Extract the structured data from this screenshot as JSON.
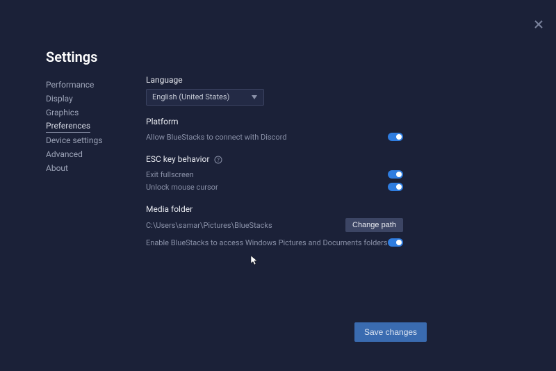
{
  "page_title": "Settings",
  "sidebar": {
    "items": [
      {
        "label": "Performance"
      },
      {
        "label": "Display"
      },
      {
        "label": "Graphics"
      },
      {
        "label": "Preferences"
      },
      {
        "label": "Device settings"
      },
      {
        "label": "Advanced"
      },
      {
        "label": "About"
      }
    ],
    "active_index": 3
  },
  "content": {
    "language": {
      "title": "Language",
      "selected": "English (United States)"
    },
    "platform": {
      "title": "Platform",
      "discord_label": "Allow BlueStacks to connect with Discord",
      "discord_on": true
    },
    "esc": {
      "title": "ESC key behavior",
      "exit_fullscreen_label": "Exit fullscreen",
      "exit_fullscreen_on": true,
      "unlock_cursor_label": "Unlock mouse cursor",
      "unlock_cursor_on": true
    },
    "media": {
      "title": "Media folder",
      "path": "C:\\Users\\samar\\Pictures\\BlueStacks",
      "change_path_label": "Change path",
      "access_label": "Enable BlueStacks to access Windows Pictures and Documents folders",
      "access_on": true
    }
  },
  "save_button": "Save changes"
}
